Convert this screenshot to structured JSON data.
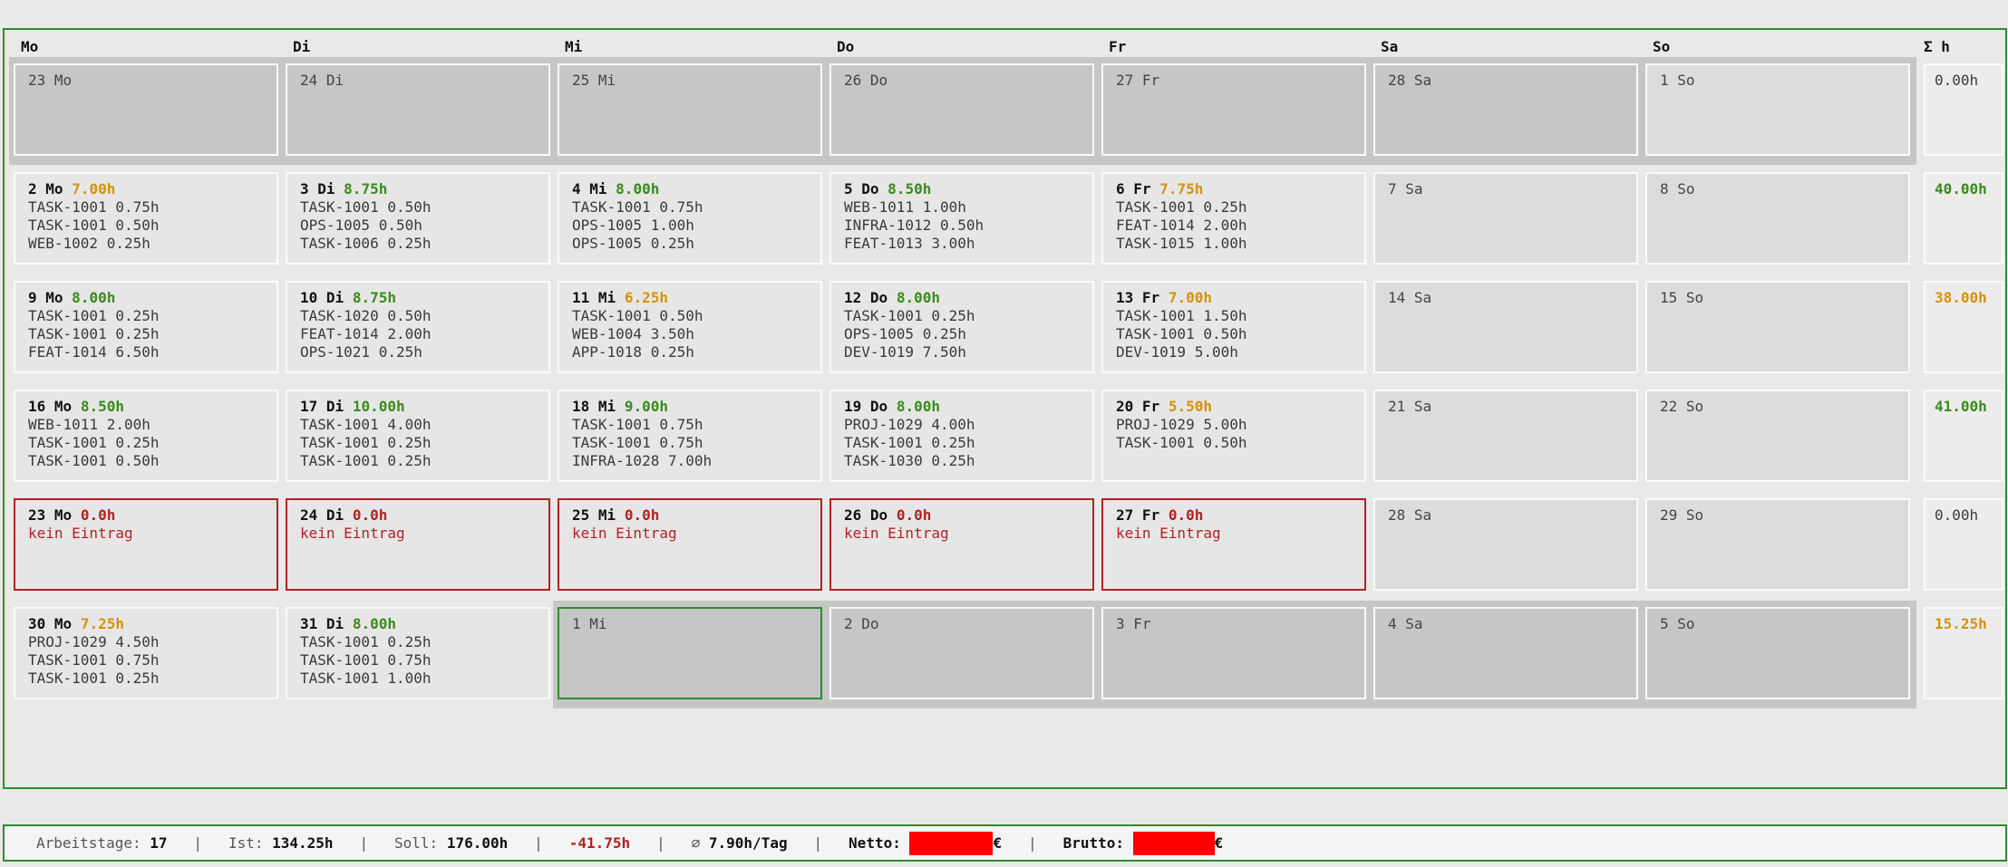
{
  "header": {
    "days": [
      "Mo",
      "Di",
      "Mi",
      "Do",
      "Fr",
      "Sa",
      "So"
    ],
    "sum": "Σ h"
  },
  "weeks": [
    {
      "days": [
        {
          "label": "23 Mo"
        },
        {
          "label": "24 Di"
        },
        {
          "label": "25 Mi"
        },
        {
          "label": "26 Do"
        },
        {
          "label": "27 Fr"
        },
        {
          "label": "28 Sa"
        },
        {
          "label": "1 So"
        }
      ],
      "sum": "0.00h"
    },
    {
      "days": [
        {
          "head": "2 Mo",
          "hours": "7.00h",
          "entries": [
            "TASK-1001 0.75h",
            "TASK-1001 0.50h",
            "WEB-1002 0.25h"
          ]
        },
        {
          "head": "3 Di",
          "hours": "8.75h",
          "entries": [
            "TASK-1001 0.50h",
            "OPS-1005 0.50h",
            "TASK-1006 0.25h"
          ]
        },
        {
          "head": "4 Mi",
          "hours": "8.00h",
          "entries": [
            "TASK-1001 0.75h",
            "OPS-1005 1.00h",
            "OPS-1005 0.25h"
          ]
        },
        {
          "head": "5 Do",
          "hours": "8.50h",
          "entries": [
            "WEB-1011 1.00h",
            "INFRA-1012 0.50h",
            "FEAT-1013 3.00h"
          ]
        },
        {
          "head": "6 Fr",
          "hours": "7.75h",
          "entries": [
            "TASK-1001 0.25h",
            "FEAT-1014 2.00h",
            "TASK-1015 1.00h"
          ]
        },
        {
          "label": "7 Sa"
        },
        {
          "label": "8 So"
        }
      ],
      "sum": "40.00h"
    },
    {
      "days": [
        {
          "head": "9 Mo",
          "hours": "8.00h",
          "entries": [
            "TASK-1001 0.25h",
            "TASK-1001 0.25h",
            "FEAT-1014 6.50h"
          ]
        },
        {
          "head": "10 Di",
          "hours": "8.75h",
          "entries": [
            "TASK-1020 0.50h",
            "FEAT-1014 2.00h",
            "OPS-1021 0.25h"
          ]
        },
        {
          "head": "11 Mi",
          "hours": "6.25h",
          "entries": [
            "TASK-1001 0.50h",
            "WEB-1004 3.50h",
            "APP-1018 0.25h"
          ]
        },
        {
          "head": "12 Do",
          "hours": "8.00h",
          "entries": [
            "TASK-1001 0.25h",
            "OPS-1005 0.25h",
            "DEV-1019 7.50h"
          ]
        },
        {
          "head": "13 Fr",
          "hours": "7.00h",
          "entries": [
            "TASK-1001 1.50h",
            "TASK-1001 0.50h",
            "DEV-1019 5.00h"
          ]
        },
        {
          "label": "14 Sa"
        },
        {
          "label": "15 So"
        }
      ],
      "sum": "38.00h"
    },
    {
      "days": [
        {
          "head": "16 Mo",
          "hours": "8.50h",
          "entries": [
            "WEB-1011 2.00h",
            "TASK-1001 0.25h",
            "TASK-1001 0.50h"
          ]
        },
        {
          "head": "17 Di",
          "hours": "10.00h",
          "entries": [
            "TASK-1001 4.00h",
            "TASK-1001 0.25h",
            "TASK-1001 0.25h"
          ]
        },
        {
          "head": "18 Mi",
          "hours": "9.00h",
          "entries": [
            "TASK-1001 0.75h",
            "TASK-1001 0.75h",
            "INFRA-1028 7.00h"
          ]
        },
        {
          "head": "19 Do",
          "hours": "8.00h",
          "entries": [
            "PROJ-1029 4.00h",
            "TASK-1001 0.25h",
            "TASK-1030 0.25h"
          ]
        },
        {
          "head": "20 Fr",
          "hours": "5.50h",
          "entries": [
            "PROJ-1029 5.00h",
            "TASK-1001 0.50h"
          ]
        },
        {
          "label": "21 Sa"
        },
        {
          "label": "22 So"
        }
      ],
      "sum": "41.00h"
    },
    {
      "days": [
        {
          "head": "23 Mo",
          "hours": "0.0h",
          "missing": "kein Eintrag"
        },
        {
          "head": "24 Di",
          "hours": "0.0h",
          "missing": "kein Eintrag"
        },
        {
          "head": "25 Mi",
          "hours": "0.0h",
          "missing": "kein Eintrag"
        },
        {
          "head": "26 Do",
          "hours": "0.0h",
          "missing": "kein Eintrag"
        },
        {
          "head": "27 Fr",
          "hours": "0.0h",
          "missing": "kein Eintrag"
        },
        {
          "label": "28 Sa"
        },
        {
          "label": "29 So"
        }
      ],
      "sum": "0.00h"
    },
    {
      "days": [
        {
          "head": "30 Mo",
          "hours": "7.25h",
          "entries": [
            "PROJ-1029 4.50h",
            "TASK-1001 0.75h",
            "TASK-1001 0.25h"
          ]
        },
        {
          "head": "31 Di",
          "hours": "8.00h",
          "entries": [
            "TASK-1001 0.25h",
            "TASK-1001 0.75h",
            "TASK-1001 1.00h"
          ]
        },
        {
          "label": "1 Mi"
        },
        {
          "label": "2 Do"
        },
        {
          "label": "3 Fr"
        },
        {
          "label": "4 Sa"
        },
        {
          "label": "5 So"
        }
      ],
      "sum": "15.25h"
    }
  ],
  "status": {
    "workdays_label": "Arbeitstage:",
    "workdays": "17",
    "ist_label": "Ist:",
    "ist": "134.25h",
    "soll_label": "Soll:",
    "soll": "176.00h",
    "diff": "-41.75h",
    "avg_label": "∅",
    "avg": "7.90h/Tag",
    "netto_label": "Netto:",
    "netto_suffix": "€",
    "brutto_label": "Brutto:",
    "brutto_suffix": "€",
    "separator": "|"
  },
  "colors": {
    "accent_green": "#2e8b2e",
    "hours_ok": "#3c8a1e",
    "hours_low": "#d4920a",
    "missing_red": "#b22222",
    "redaction": "#ff0000"
  }
}
